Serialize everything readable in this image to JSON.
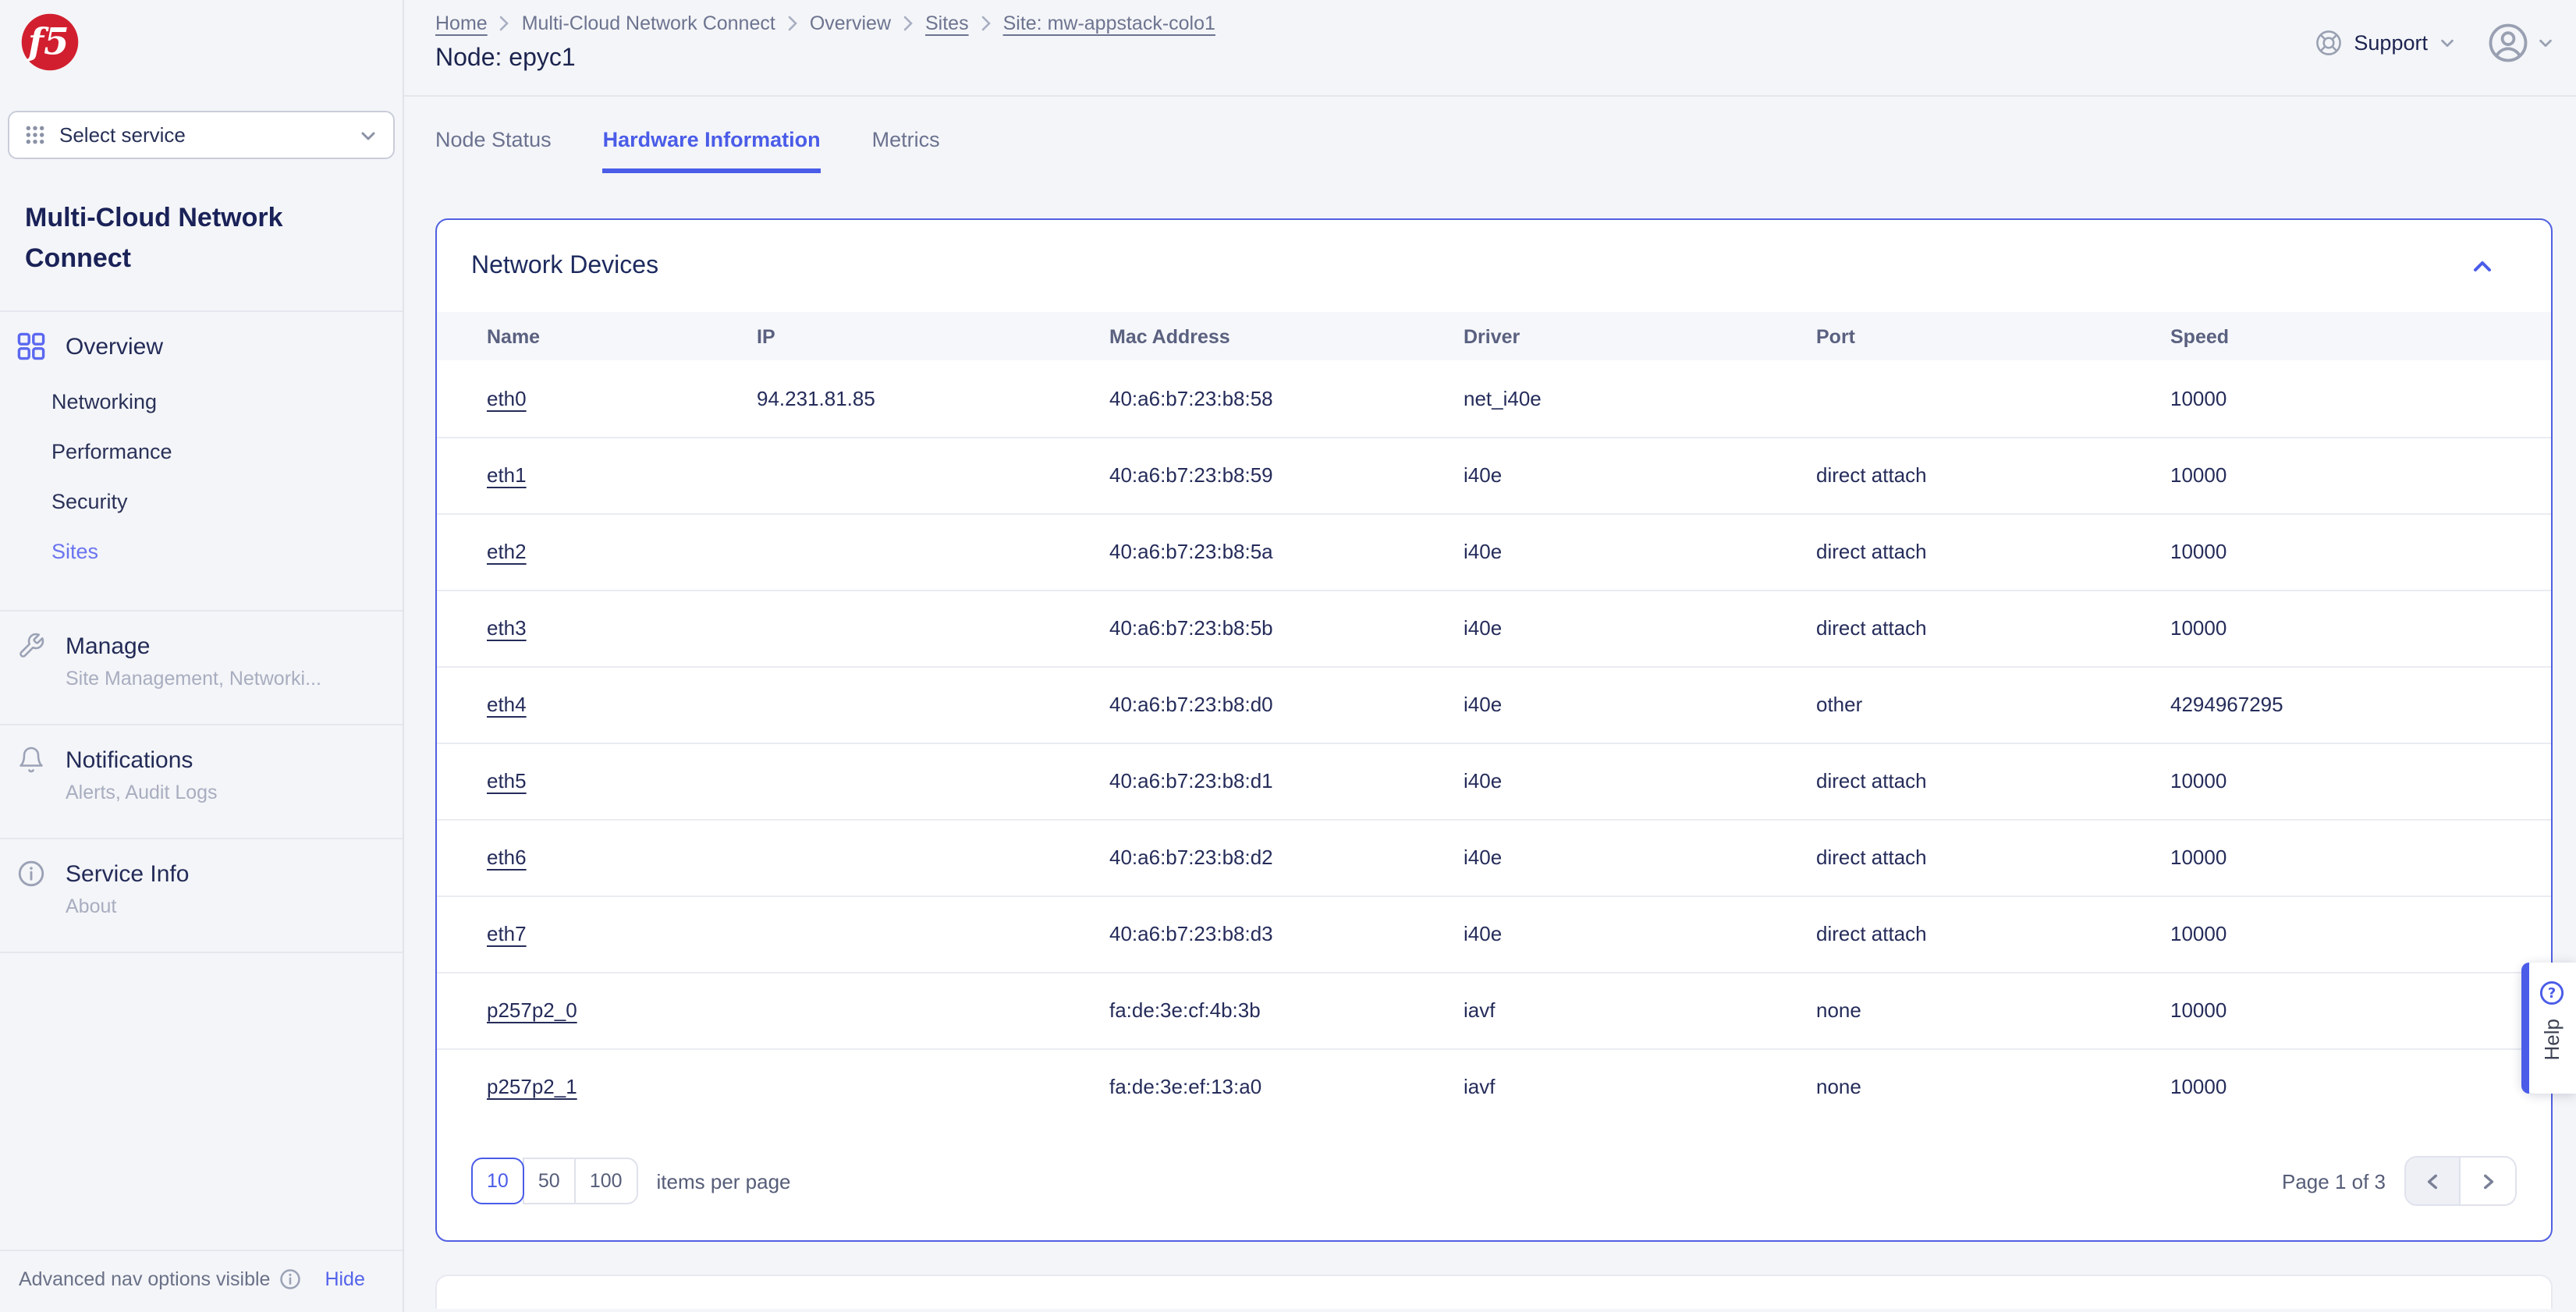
{
  "brand": {
    "logo_text": "f5"
  },
  "topbar": {
    "breadcrumb": [
      {
        "label": "Home",
        "link": true
      },
      {
        "label": "Multi-Cloud Network Connect",
        "link": false
      },
      {
        "label": "Overview",
        "link": false
      },
      {
        "label": "Sites",
        "link": true
      },
      {
        "label": "Site: mw-appstack-colo1",
        "link": true
      }
    ],
    "page_title": "Node: epyc1",
    "support_label": "Support"
  },
  "sidebar": {
    "select_service_label": "Select service",
    "service_title": "Multi-Cloud Network Connect",
    "overview": {
      "label": "Overview",
      "items": [
        {
          "label": "Networking"
        },
        {
          "label": "Performance"
        },
        {
          "label": "Security"
        },
        {
          "label": "Sites",
          "active": true
        }
      ]
    },
    "sections": [
      {
        "label": "Manage",
        "subtitle": "Site Management, Networki..."
      },
      {
        "label": "Notifications",
        "subtitle": "Alerts, Audit Logs"
      },
      {
        "label": "Service Info",
        "subtitle": "About"
      }
    ],
    "footer": {
      "text": "Advanced nav options visible",
      "action": "Hide"
    }
  },
  "tabs": [
    {
      "label": "Node Status",
      "active": false
    },
    {
      "label": "Hardware Information",
      "active": true
    },
    {
      "label": "Metrics",
      "active": false
    }
  ],
  "panel": {
    "title": "Network Devices",
    "table": {
      "columns": [
        "Name",
        "IP",
        "Mac Address",
        "Driver",
        "Port",
        "Speed"
      ],
      "rows": [
        [
          "eth0",
          "94.231.81.85",
          "40:a6:b7:23:b8:58",
          "net_i40e",
          "",
          "10000"
        ],
        [
          "eth1",
          "",
          "40:a6:b7:23:b8:59",
          "i40e",
          "direct attach",
          "10000"
        ],
        [
          "eth2",
          "",
          "40:a6:b7:23:b8:5a",
          "i40e",
          "direct attach",
          "10000"
        ],
        [
          "eth3",
          "",
          "40:a6:b7:23:b8:5b",
          "i40e",
          "direct attach",
          "10000"
        ],
        [
          "eth4",
          "",
          "40:a6:b7:23:b8:d0",
          "i40e",
          "other",
          "4294967295"
        ],
        [
          "eth5",
          "",
          "40:a6:b7:23:b8:d1",
          "i40e",
          "direct attach",
          "10000"
        ],
        [
          "eth6",
          "",
          "40:a6:b7:23:b8:d2",
          "i40e",
          "direct attach",
          "10000"
        ],
        [
          "eth7",
          "",
          "40:a6:b7:23:b8:d3",
          "i40e",
          "direct attach",
          "10000"
        ],
        [
          "p257p2_0",
          "",
          "fa:de:3e:cf:4b:3b",
          "iavf",
          "none",
          "10000"
        ],
        [
          "p257p2_1",
          "",
          "fa:de:3e:ef:13:a0",
          "iavf",
          "none",
          "10000"
        ]
      ]
    },
    "pagination": {
      "page_sizes": [
        "10",
        "50",
        "100"
      ],
      "selected_size": "10",
      "items_per_page_label": "items per page",
      "page_status": "Page 1 of 3"
    }
  },
  "help": {
    "label": "Help"
  },
  "icons": {
    "logo": "f5-logo",
    "service_selector": "grid-dots-icon",
    "overview": "grid-icon",
    "manage": "wrench-icon",
    "notifications": "bell-icon",
    "service_info": "info-circle-icon",
    "support": "lifebuoy-icon",
    "account": "avatar-icon",
    "panel_collapse": "chevron-up-icon",
    "help": "question-circle-icon"
  },
  "colors": {
    "accent": "#4a5ce8",
    "brand_red": "#d21f2f",
    "navy": "#232b58",
    "active_nav": "#6974f0"
  }
}
